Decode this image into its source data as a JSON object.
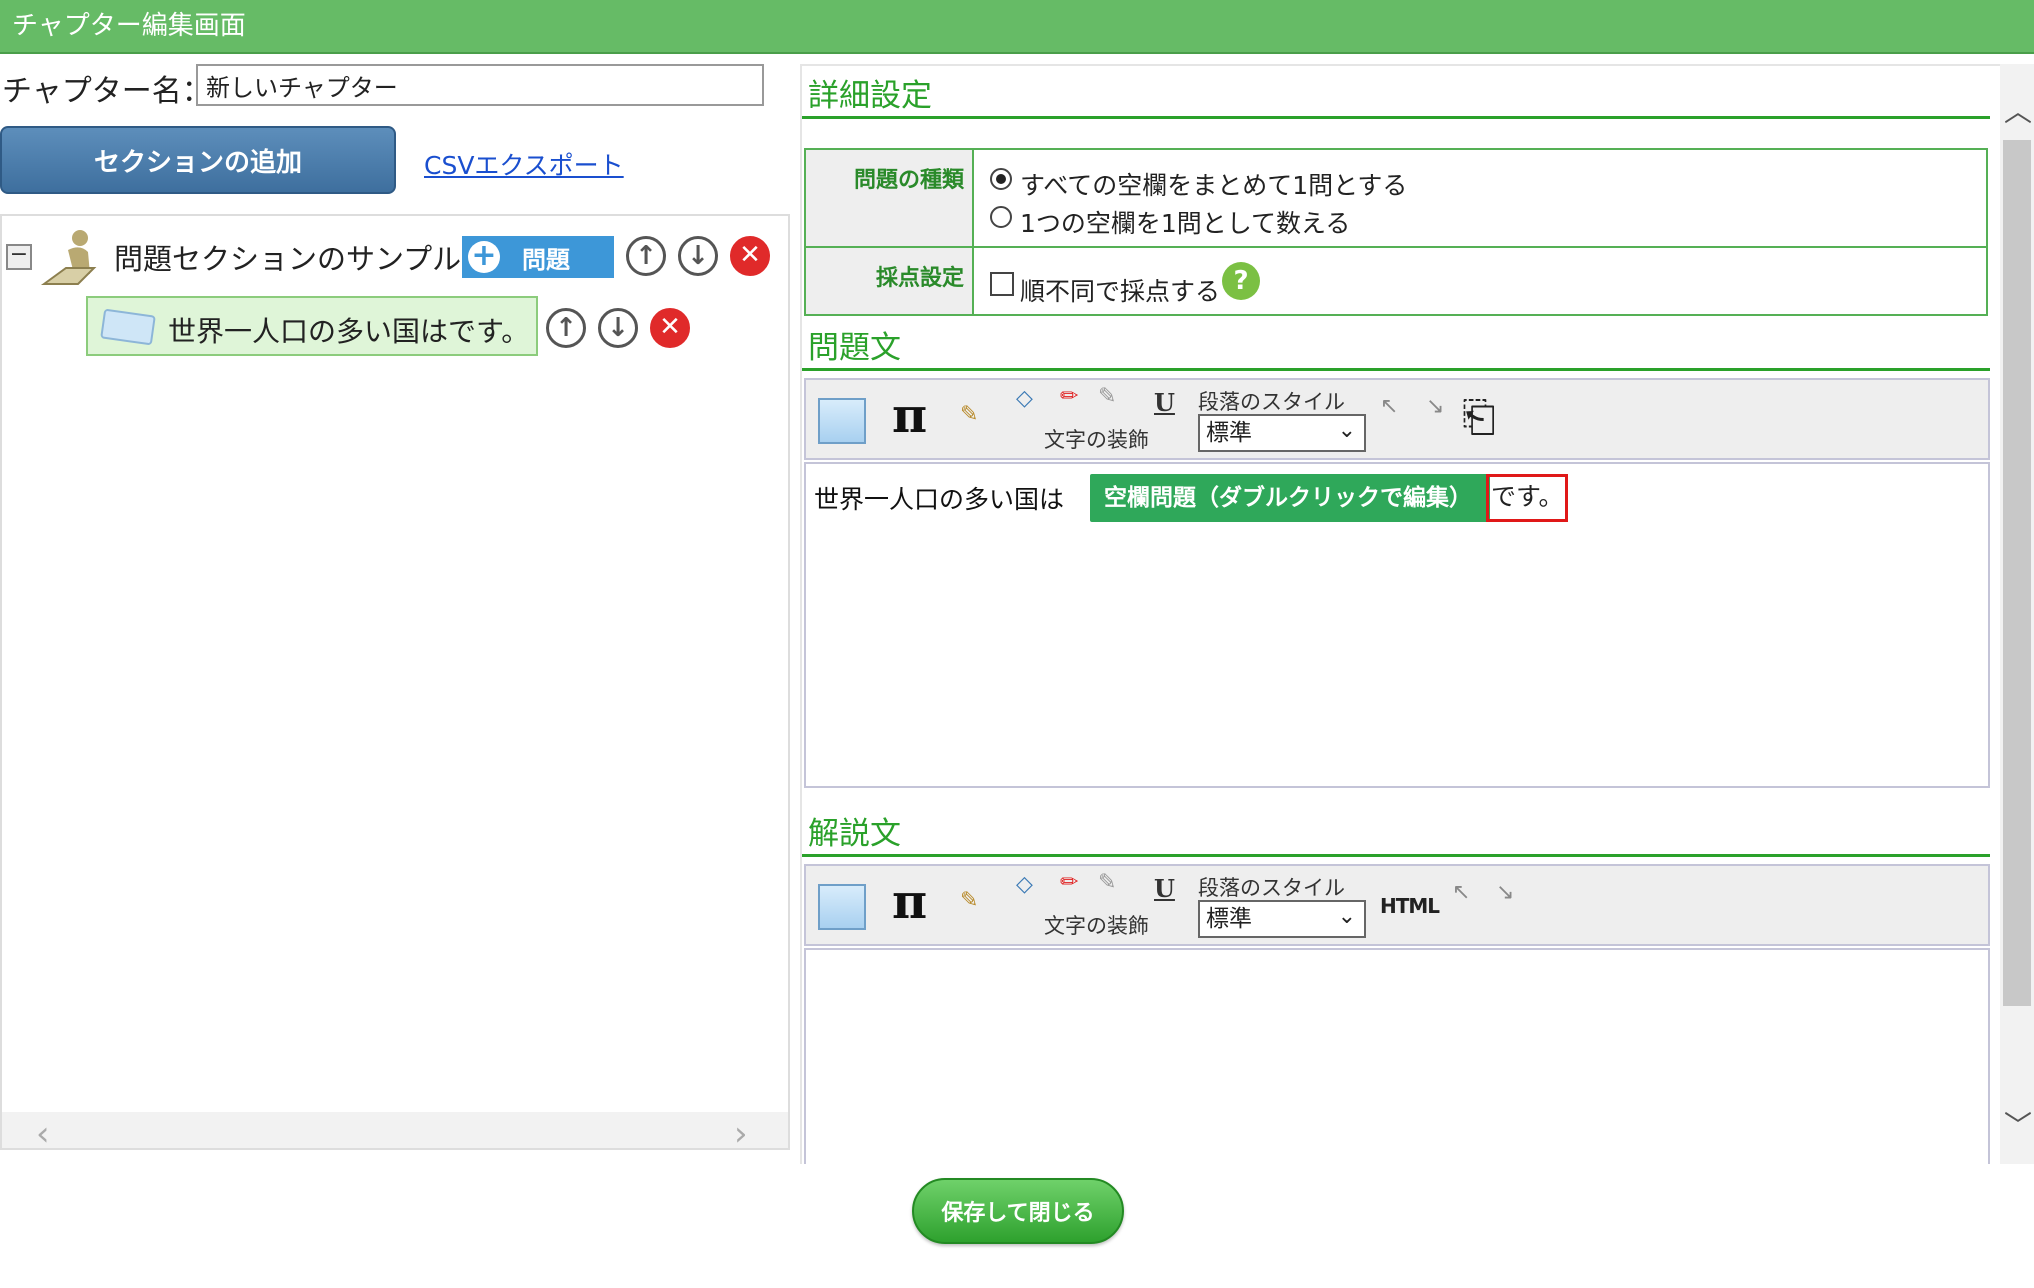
{
  "title": "チャプター編集画面",
  "chapter": {
    "label": "チャプター名：",
    "name_value": "新しいチャプター"
  },
  "actions": {
    "add_section": "セクションの追加",
    "csv_export": "CSVエクスポート"
  },
  "tree": {
    "section": {
      "title": "問題セクションのサンプル",
      "add_question": "問題"
    },
    "question": {
      "title": "世界一人口の多い国はです。"
    }
  },
  "details": {
    "heading": "詳細設定",
    "question_type_label": "問題の種類",
    "question_type_options": [
      "すべての空欄をまとめて1問とする",
      "1つの空欄を1問として数える"
    ],
    "question_type_selected": 0,
    "scoring_label": "採点設定",
    "scoring_option": "順不同で採点する",
    "scoring_checked": false
  },
  "question_text": {
    "heading": "問題文",
    "content_before": "世界一人口の多い国は",
    "blank_chip": "空欄問題（ダブルクリックで編集）",
    "content_after": "です。"
  },
  "explanation": {
    "heading": "解説文"
  },
  "toolbar": {
    "text_decoration_label": "文字の装飾",
    "paragraph_style_label": "段落のスタイル",
    "paragraph_style_value": "標準",
    "html_label": "HTML",
    "icons": [
      "image-icon",
      "pi-icon",
      "brush-icon",
      "eraser-icon",
      "red-pen-icon",
      "highlighter-icon",
      "underline-icon",
      "indent-icon",
      "outdent-icon",
      "insert-icon"
    ]
  },
  "footer": {
    "save_close": "保存して閉じる"
  },
  "colors": {
    "title_bar": "#66bb66",
    "heading_green": "#2aa12a",
    "primary_blue": "#3e6f9e",
    "blank_chip": "#2fa85a",
    "highlight_red": "#e01818"
  }
}
